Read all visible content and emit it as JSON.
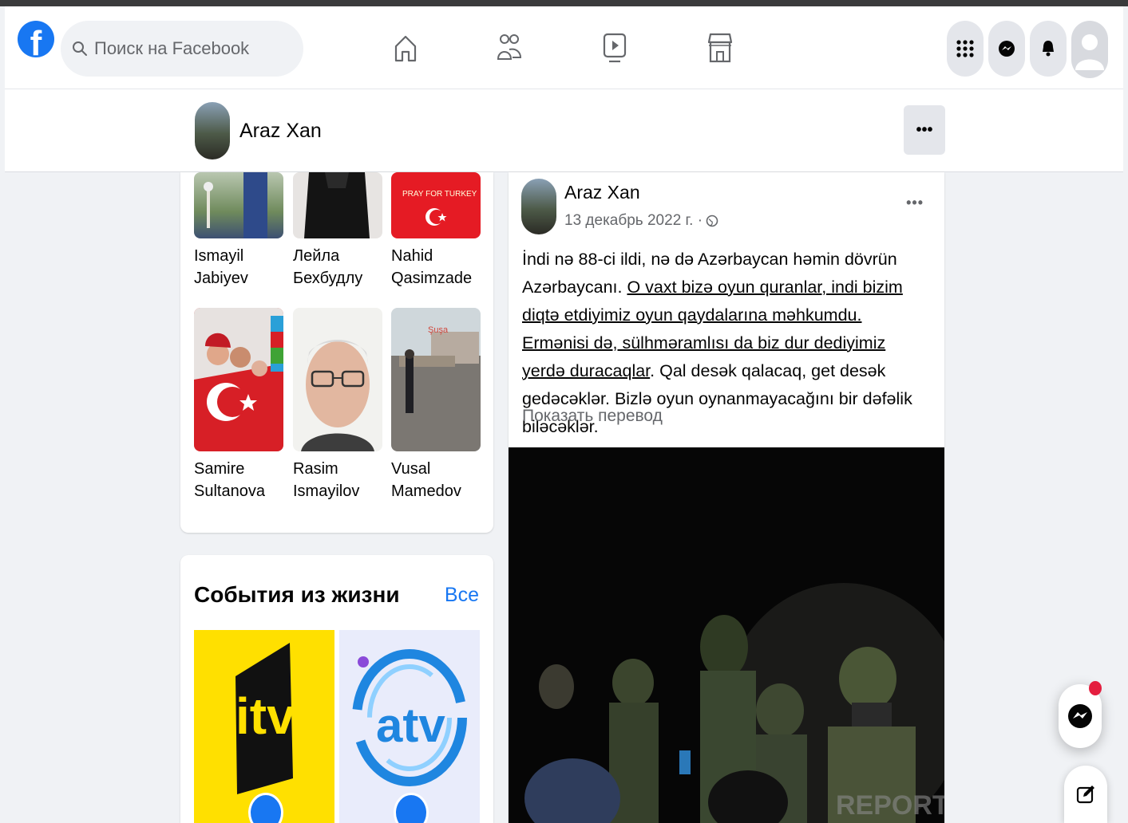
{
  "search": {
    "placeholder": "Поиск на Facebook"
  },
  "nav": [
    "home-icon",
    "friends-icon",
    "watch-icon",
    "marketplace-icon"
  ],
  "header_buttons": [
    "menu-grid-icon",
    "messenger-icon",
    "bell-icon",
    "avatar"
  ],
  "profile": {
    "name": "Araz Xan",
    "more": "•••"
  },
  "friends": [
    {
      "name": "Ismayil Jabiyev"
    },
    {
      "name": "Лейла Бехбудлу"
    },
    {
      "name": "Nahid Qasimzade",
      "photo_text": "PRAY FOR TURKEY"
    },
    {
      "name": "Samire Sultanova"
    },
    {
      "name": "Rasim Ismayilov"
    },
    {
      "name": "Vusal Mamedov",
      "photo_text": "Şuşa"
    }
  ],
  "events": {
    "title": "События из жизни",
    "all": "Все",
    "tiles": [
      {
        "logo": "itv",
        "colors": {
          "bg": "#ffe000",
          "fg": "#111111"
        }
      },
      {
        "logo": "atv",
        "colors": {
          "bg": "#e9ecfb",
          "fg": "#1f86e0"
        }
      }
    ]
  },
  "post": {
    "author": "Araz Xan",
    "date": "13 декабрь 2022 г. ·",
    "more": "•••",
    "text_a": "İndi nə 88-ci ildi, nə də Azərbaycan həmin dövrün Azərbaycanı. ",
    "text_b": "O vaxt bizə oyun quranlar, indi bizim diqtə etdiyimiz oyun qaydalarına məhkumdu. Ermənisi də, sülhməramlısı da biz dur dediyimiz yerdə duracaqlar",
    "text_c": ". Qal desək qalacaq, get desək gedəcəklər. Bizlə oyun oynanmayacağını bir dəfəlik biləcəklər.",
    "translate": "Показать перевод",
    "watermark": "REPORT"
  },
  "colors": {
    "accent": "#1877f2",
    "text": "#050505",
    "secondary": "#65676b",
    "bg": "#f0f2f5"
  }
}
